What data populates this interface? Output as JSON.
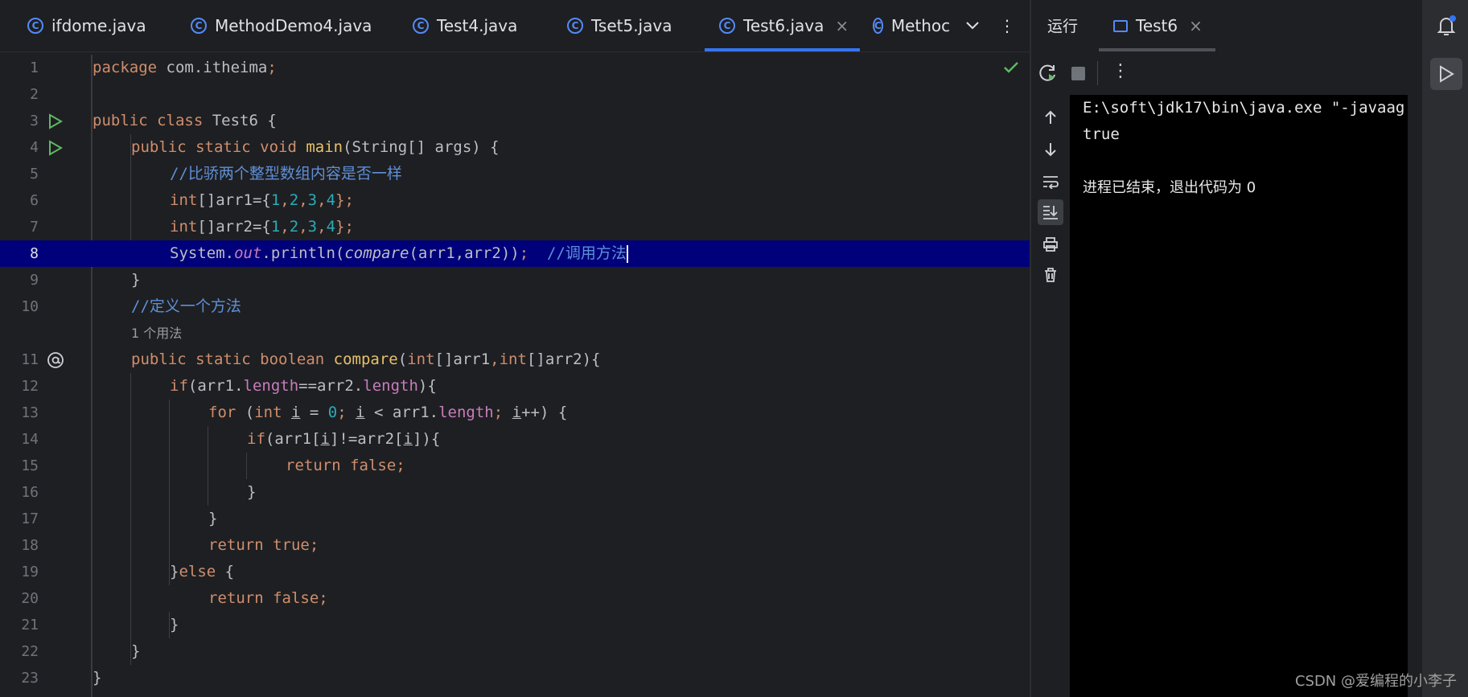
{
  "tabs": [
    {
      "label": "ifdome.java"
    },
    {
      "label": "MethodDemo4.java"
    },
    {
      "label": "Test4.java"
    },
    {
      "label": "Tset5.java"
    },
    {
      "label": "Test6.java",
      "active": true
    },
    {
      "label": "Methoc"
    }
  ],
  "tab_close": "×",
  "tab_overflow": "⌄",
  "tab_menu": "⋮",
  "line_numbers": [
    "1",
    "2",
    "3",
    "4",
    "5",
    "6",
    "7",
    "8",
    "9",
    "10",
    "11",
    "12",
    "13",
    "14",
    "15",
    "16",
    "17",
    "18",
    "19",
    "20",
    "21",
    "22",
    "23"
  ],
  "usage_hint": "1 个用法",
  "code": {
    "l1_kw": "package",
    "l1_rest": " com.itheima",
    "l1_semi": ";",
    "l3_kw": "public class",
    "l3_rest": " Test6 {",
    "l4_kw": "public static void",
    "l4_fn": " main",
    "l4_rest": "(String[] args) {",
    "l5_cm": "//比骄两个整型数组内容是否一样",
    "l6_kw": "int",
    "l6_a": "[]arr1={",
    "l6_n1": "1",
    "l6_n2": "2",
    "l6_n3": "3",
    "l6_n4": "4",
    "l6_end": "};",
    "l7_kw": "int",
    "l7_a": "[]arr2={",
    "l7_n1": "1",
    "l7_n2": "2",
    "l7_n3": "3",
    "l7_n4": "4",
    "l7_end": "};",
    "l8_a": "System.",
    "l8_out": "out",
    "l8_b": ".println(",
    "l8_call": "compare",
    "l8_c": "(arr1,arr2))",
    "l8_semi": ";",
    "l8_cm": "  //调用方法",
    "l9": "}",
    "l10_cm": "//定义一个方法",
    "l11_kw": "public static boolean",
    "l11_fn": " compare",
    "l11_a": "(",
    "l11_int1": "int",
    "l11_b": "[]arr1",
    "l11_comma": ",",
    "l11_int2": "int",
    "l11_c": "[]arr2){",
    "l12_kw": "if",
    "l12_a": "(arr1.",
    "l12_f1": "length",
    "l12_b": "==arr2.",
    "l12_f2": "length",
    "l12_c": "){",
    "l13_kw": "for",
    "l13_a": " (",
    "l13_int": "int",
    "l13_i1": "i",
    "l13_b": " = ",
    "l13_zero": "0",
    "l13_semi1": ";",
    "l13_i2": "i",
    "l13_c": " < arr1.",
    "l13_len": "length",
    "l13_semi2": ";",
    "l13_i3": "i",
    "l13_d": "++) {",
    "l14_kw": "if",
    "l14_a": "(arr1[",
    "l14_i1": "i",
    "l14_b": "]!=arr2[",
    "l14_i2": "i",
    "l14_c": "]){",
    "l15_kw": "return false",
    "l15_semi": ";",
    "l16": "}",
    "l17": "}",
    "l18_kw": "return true",
    "l18_semi": ";",
    "l19_a": "}",
    "l19_kw": "else",
    "l19_b": " {",
    "l20_kw": "return false",
    "l20_semi": ";",
    "l21": "}",
    "l22": "}",
    "l23": "}"
  },
  "run_panel": {
    "title": "运行",
    "tab_label": "Test6",
    "close": "×",
    "menu": "⋮",
    "console_lines": [
      "E:\\soft\\jdk17\\bin\\java.exe \"-javaag",
      "true",
      "",
      "进程已结束，退出代码为 0"
    ]
  },
  "watermark": "CSDN @爱编程的小李子",
  "colors": {
    "accent": "#3574f0",
    "highlight_line": "#00007a",
    "run_green": "#5fb865"
  }
}
